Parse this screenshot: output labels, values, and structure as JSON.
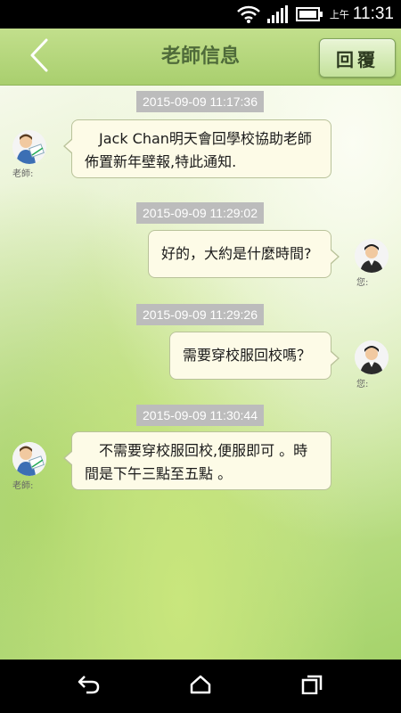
{
  "status_bar": {
    "time_prefix": "上午",
    "time": "11:31",
    "icons": [
      "wifi-icon",
      "signal-icon",
      "battery-icon"
    ]
  },
  "header": {
    "back_icon": "chevron-left-icon",
    "title": "老師信息",
    "reply_label": "回覆"
  },
  "messages": [
    {
      "timestamp": "2015-09-09 11:17:36",
      "sender": "teacher",
      "sender_label": "老師:",
      "lines": [
        "Jack Chan明天會回學校協助老師",
        "佈置新年壁報,特此通知."
      ]
    },
    {
      "timestamp": "2015-09-09 11:29:02",
      "sender": "you",
      "sender_label": "您:",
      "lines": [
        "好的，大約是什麼時間?"
      ]
    },
    {
      "timestamp": "2015-09-09 11:29:26",
      "sender": "you",
      "sender_label": "您:",
      "lines": [
        "需要穿校服回校嗎？"
      ]
    },
    {
      "timestamp": "2015-09-09 11:30:44",
      "sender": "teacher",
      "sender_label": "老師:",
      "lines": [
        "不需要穿校服回校,便服即可 。時",
        "間是下午三點至五點 。"
      ]
    }
  ],
  "nav_bar": {
    "icons": [
      "back-nav-icon",
      "home-nav-icon",
      "recents-nav-icon"
    ]
  },
  "colors": {
    "header_green": "#b5d77c",
    "title_color": "#4f6b3a",
    "bubble_bg": "#fdfbe7",
    "timestamp_bg": "#bcbcbc"
  }
}
